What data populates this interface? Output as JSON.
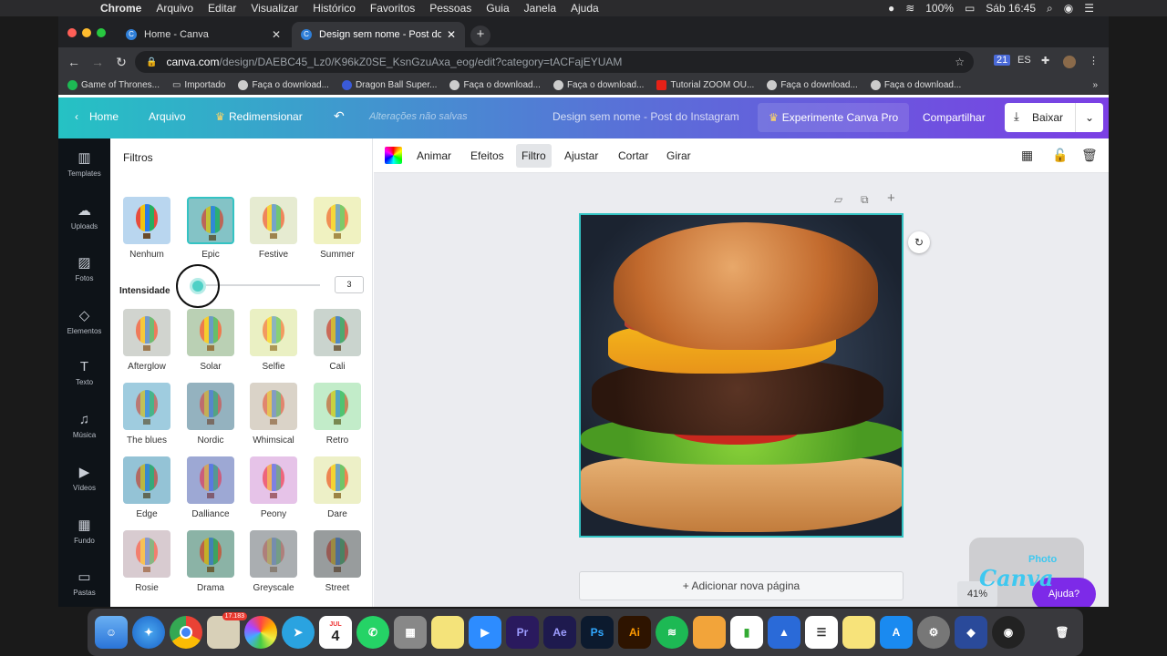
{
  "menubar": {
    "app": "Chrome",
    "items": [
      "Arquivo",
      "Editar",
      "Visualizar",
      "Histórico",
      "Favoritos",
      "Pessoas",
      "Guia",
      "Janela",
      "Ajuda"
    ],
    "battery": "100%",
    "clock": "Sáb 16:45"
  },
  "browser": {
    "tabs": [
      {
        "title": "Home - Canva"
      },
      {
        "title": "Design sem nome - Post do Ins"
      }
    ],
    "url_host": "canva.com",
    "url_path": "/design/DAEBC45_Lz0/K96kZ0SE_KsnGzuAxa_eog/edit?category=tACFajEYUAM",
    "bookmarks": [
      "Game of Thrones...",
      "Importado",
      "Faça o download...",
      "Dragon Ball Super...",
      "Faça o download...",
      "Faça o download...",
      "Tutorial ZOOM OU...",
      "Faça o download...",
      "Faça o download..."
    ],
    "ext_badge": "21",
    "ext_lang": "ES"
  },
  "header": {
    "home": "Home",
    "file": "Arquivo",
    "resize": "Redimensionar",
    "unsaved": "Alterações não salvas",
    "doc_title": "Design sem nome - Post do Instagram",
    "pro": "Experimente Canva Pro",
    "share": "Compartilhar",
    "download": "Baixar"
  },
  "rail": [
    {
      "label": "Templates",
      "icon": "templates-icon"
    },
    {
      "label": "Uploads",
      "icon": "upload-icon"
    },
    {
      "label": "Fotos",
      "icon": "photo-icon"
    },
    {
      "label": "Elementos",
      "icon": "elements-icon"
    },
    {
      "label": "Texto",
      "icon": "text-icon"
    },
    {
      "label": "Música",
      "icon": "music-icon"
    },
    {
      "label": "Vídeos",
      "icon": "video-icon"
    },
    {
      "label": "Fundo",
      "icon": "background-icon"
    },
    {
      "label": "Pastas",
      "icon": "folder-icon"
    }
  ],
  "panel": {
    "title": "Filtros",
    "intensity_label": "Intensidade",
    "intensity_value": "3",
    "intensity_level": 3,
    "selected": "Epic",
    "filters": [
      "Nenhum",
      "Epic",
      "Festive",
      "Summer",
      "Afterglow",
      "Solar",
      "Selfie",
      "Cali",
      "The blues",
      "Nordic",
      "Whimsical",
      "Retro",
      "Edge",
      "Dalliance",
      "Peony",
      "Dare",
      "Rosie",
      "Drama",
      "Greyscale",
      "Street"
    ]
  },
  "toolbar": {
    "animate": "Animar",
    "effects": "Efeitos",
    "filter": "Filtro",
    "adjust": "Ajustar",
    "crop": "Cortar",
    "rotate": "Girar"
  },
  "canvas": {
    "add_page": "+ Adicionar nova página",
    "zoom": "41%",
    "help": "Ajuda?",
    "watermark_photo": "Photo",
    "watermark_canva": "Canva"
  },
  "dock": {
    "badge": "17.183",
    "calendar_day": "4",
    "calendar_month": "JUL"
  }
}
